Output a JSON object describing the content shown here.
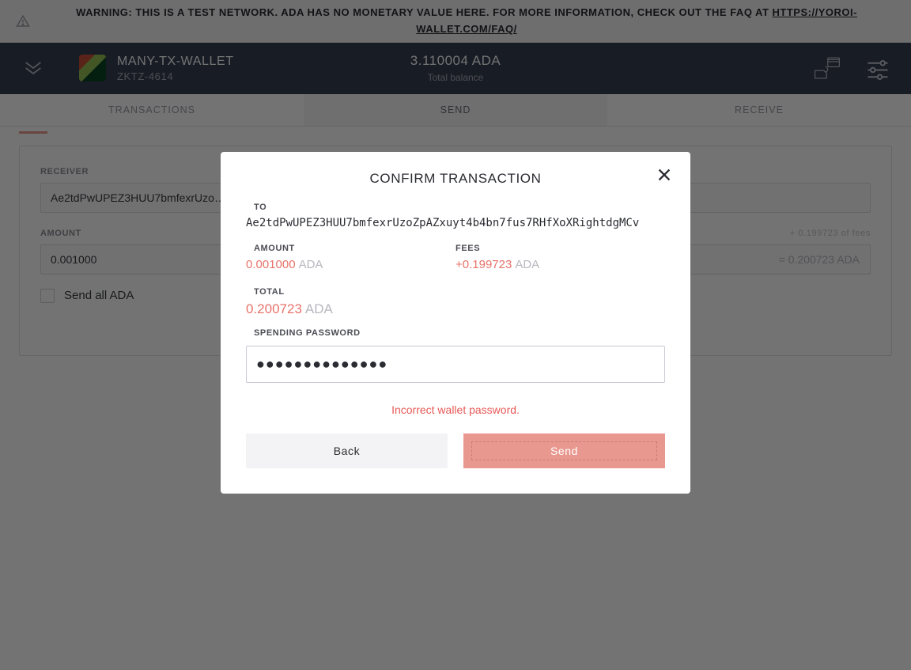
{
  "banner": {
    "prefix": "WARNING: THIS IS A TEST NETWORK. ADA HAS NO MONETARY VALUE HERE. FOR MORE INFORMATION, CHECK OUT THE FAQ AT ",
    "link_text": "HTTPS://YOROI-WALLET.COM/FAQ/"
  },
  "header": {
    "wallet_name": "MANY-TX-WALLET",
    "wallet_sub": "ZKTZ-4614",
    "balance_amount": "3.110004 ADA",
    "balance_label": "Total balance"
  },
  "tabs": {
    "transactions": "TRANSACTIONS",
    "send": "SEND",
    "receive": "RECEIVE"
  },
  "form": {
    "receiver_label": "RECEIVER",
    "receiver_value": "Ae2tdPwUPEZ3HUU7bmfexrUzo…",
    "amount_label": "AMOUNT",
    "amount_value": "0.001000",
    "fees_hint": "+ 0.199723 of fees",
    "total_inline": "= 0.200723 ADA",
    "send_all_label": "Send all ADA"
  },
  "modal": {
    "title": "CONFIRM TRANSACTION",
    "to_label": "TO",
    "to_value": "Ae2tdPwUPEZ3HUU7bmfexrUzoZpAZxuyt4b4bn7fus7RHfXoXRightdgMCv",
    "amount_label": "AMOUNT",
    "amount_value": "0.001000",
    "amount_unit": "ADA",
    "fees_label": "FEES",
    "fees_value": "+0.199723",
    "fees_unit": "ADA",
    "total_label": "TOTAL",
    "total_value": "0.200723",
    "total_unit": "ADA",
    "pw_label": "SPENDING PASSWORD",
    "pw_value": "●●●●●●●●●●●●●●",
    "error": "Incorrect wallet password.",
    "back_label": "Back",
    "send_label": "Send"
  },
  "colors": {
    "accent": "#e9988f",
    "error": "#e65a57",
    "header_bg": "#373f52"
  }
}
